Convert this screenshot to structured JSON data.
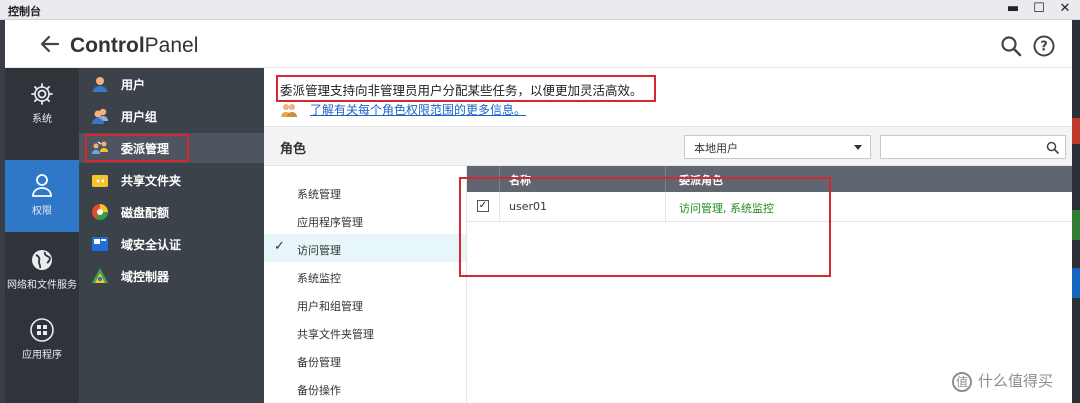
{
  "window": {
    "title": "控制台"
  },
  "header": {
    "brand_bold": "Control",
    "brand_light": "Panel"
  },
  "left_nav": [
    {
      "label": "系统",
      "icon": "gear-icon"
    },
    {
      "label": "权限",
      "icon": "user-icon",
      "active": true
    },
    {
      "label": "网络和文件服务",
      "icon": "globe-icon"
    },
    {
      "label": "应用程序",
      "icon": "apps-grid-icon"
    }
  ],
  "sub_nav": [
    {
      "label": "用户",
      "icon": "user-icon",
      "color": "#f0b37a"
    },
    {
      "label": "用户组",
      "icon": "group-icon",
      "color": "#f0b37a"
    },
    {
      "label": "委派管理",
      "icon": "delegate-icon",
      "color": "#6aa9e9",
      "active": true
    },
    {
      "label": "共享文件夹",
      "icon": "shared-folder-icon",
      "color": "#f6c32c"
    },
    {
      "label": "磁盘配额",
      "icon": "disk-quota-icon",
      "color": "#e24b2c"
    },
    {
      "label": "域安全认证",
      "icon": "domain-auth-icon",
      "color": "#1e6fd9"
    },
    {
      "label": "域控制器",
      "icon": "domain-controller-icon",
      "color": "#3fa34d"
    }
  ],
  "main": {
    "description": "委派管理支持向非管理员用户分配某些任务，以便更加灵活高效。",
    "more_link": "了解有关每个角色权限范围的更多信息。",
    "roles_title": "角色",
    "user_source": "本地用户",
    "roles": [
      {
        "label": "系统管理"
      },
      {
        "label": "应用程序管理"
      },
      {
        "label": "访问管理",
        "selected": true
      },
      {
        "label": "系统监控"
      },
      {
        "label": "用户和组管理"
      },
      {
        "label": "共享文件夹管理"
      },
      {
        "label": "备份管理"
      },
      {
        "label": "备份操作"
      }
    ],
    "table": {
      "columns": [
        "名称",
        "委派角色"
      ],
      "rows": [
        {
          "checked": true,
          "name": "user01",
          "roles": "访问管理, 系统监控"
        }
      ]
    }
  },
  "watermark": {
    "badge": "值",
    "text": "什么值得买"
  },
  "colors": {
    "accent": "#2f78c8",
    "highlight": "#d6262f",
    "link": "#1b63c6",
    "role_green": "#1f8a1f"
  }
}
